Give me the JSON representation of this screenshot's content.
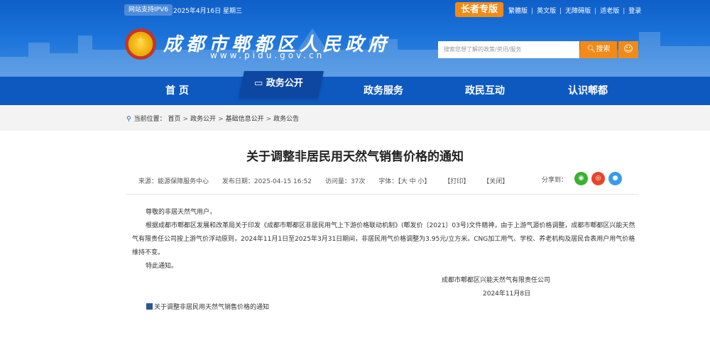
{
  "topbar": {
    "ipv6": "网站支持IPV6",
    "date": "2025年4月16日   星期三",
    "elder": "长者专版",
    "links": [
      "繁體版",
      "英文版",
      "无障碍版",
      "适老版",
      "登录"
    ]
  },
  "site": {
    "name": "成都市郫都区人民政府",
    "domain": "www.pidu.gov.cn"
  },
  "search": {
    "placeholder": "搜索您想了解的政策/资讯/服务",
    "button": "搜索"
  },
  "nav": {
    "items": [
      "首 页",
      "政务公开",
      "政务服务",
      "政民互动",
      "认识郫都"
    ],
    "active": "政务公开"
  },
  "breadcrumb": {
    "label": "当前位置：",
    "items": [
      "首页",
      "政务公开",
      "基础信息公开",
      "政务公告"
    ]
  },
  "article": {
    "title": "关于调整非居民用天然气销售价格的通知",
    "source": "来源：能源保障服务中心",
    "date": "发布日期：2025-04-15 16:52",
    "views": "访问量：37次",
    "font": "字体：【大 中 小】",
    "print": "【打印】",
    "close": "【关闭】",
    "share": "分享到：",
    "greeting": "尊敬的非居天然气用户，",
    "paragraph": "根据成都市郫都区发展和改革局关于印发《成都市郫都区非居民用气上下游价格联动机制》(郫发价〔2021〕03号)文件精神，由于上游气源价格调整，成都市郫都区兴能天然气有限责任公司按上游气价浮动原则，2024年11月1日至2025年3月31日期间，非居民用气价格调整为3.95元/立方米。CNG加工用气、学校、养老机构及居民合表用户用气价格维持不变。",
    "closing": "特此通知。",
    "sign_org": "成都市郫都区兴能天然气有限责任公司",
    "sign_date": "2024年11月8日",
    "attachment": "关于调整非居民用天然气销售价格的通知"
  },
  "colors": {
    "header_blue": "#1a72d9",
    "nav_blue": "#0e59c0",
    "accent_orange": "#f28a17"
  }
}
